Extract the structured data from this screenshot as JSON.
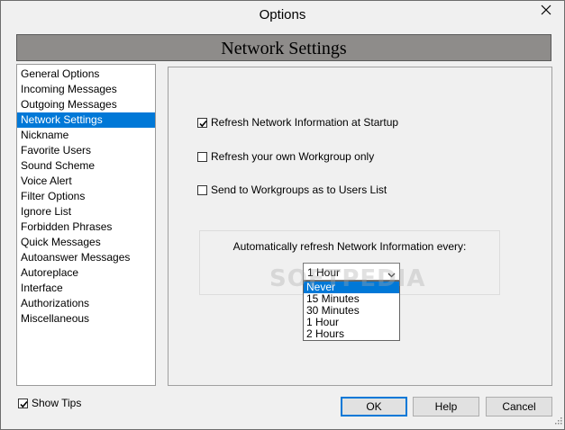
{
  "window": {
    "title": "Options"
  },
  "header": {
    "title": "Network Settings"
  },
  "nav": {
    "items": [
      {
        "label": "General Options",
        "selected": false
      },
      {
        "label": "Incoming Messages",
        "selected": false
      },
      {
        "label": "Outgoing Messages",
        "selected": false
      },
      {
        "label": "Network Settings",
        "selected": true
      },
      {
        "label": "Nickname",
        "selected": false
      },
      {
        "label": "Favorite Users",
        "selected": false
      },
      {
        "label": "Sound Scheme",
        "selected": false
      },
      {
        "label": "Voice Alert",
        "selected": false
      },
      {
        "label": "Filter Options",
        "selected": false
      },
      {
        "label": "Ignore List",
        "selected": false
      },
      {
        "label": "Forbidden Phrases",
        "selected": false
      },
      {
        "label": "Quick Messages",
        "selected": false
      },
      {
        "label": "Autoanswer Messages",
        "selected": false
      },
      {
        "label": "Autoreplace",
        "selected": false
      },
      {
        "label": "Interface",
        "selected": false
      },
      {
        "label": "Authorizations",
        "selected": false
      },
      {
        "label": "Miscellaneous",
        "selected": false
      }
    ]
  },
  "settings": {
    "refresh_startup": {
      "label": "Refresh Network Information at Startup",
      "checked": true
    },
    "refresh_workgroup": {
      "label": "Refresh your own Workgroup only",
      "checked": false
    },
    "send_workgroups": {
      "label": "Send to Workgroups as to Users List",
      "checked": false
    },
    "auto_refresh": {
      "label": "Automatically refresh Network Information every:",
      "value": "1 Hour",
      "options": [
        "Never",
        "15 Minutes",
        "30 Minutes",
        "1 Hour",
        "2 Hours"
      ],
      "highlighted": "Never"
    }
  },
  "footer": {
    "show_tips": {
      "label": "Show Tips",
      "checked": true
    },
    "ok_label": "OK",
    "help_label": "Help",
    "cancel_label": "Cancel"
  },
  "watermark": "SOFTPEDIA",
  "colors": {
    "selection": "#0078d7",
    "header_band": "#8e8c8a"
  },
  "icons": {
    "close": "close-icon",
    "check": "check-icon",
    "dropdown": "chevron-down-icon",
    "grip": "resize-grip-icon"
  }
}
